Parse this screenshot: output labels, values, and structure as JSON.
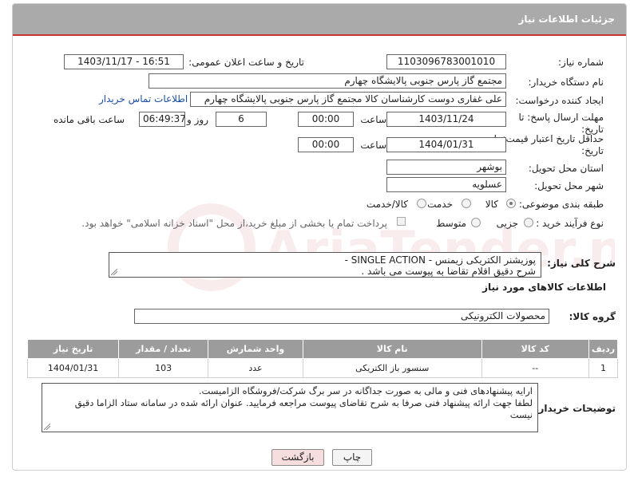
{
  "header": {
    "title": "جزئیات اطلاعات نیاز"
  },
  "watermark": {
    "text": "AriaTender.neT"
  },
  "fields": {
    "need_number_label": "شماره نیاز:",
    "need_number": "1103096783001010",
    "announce_label": "تاریخ و ساعت اعلان عمومی:",
    "announce_value": "1403/11/17 - 16:51",
    "buyer_label": "نام دستگاه خریدار:",
    "buyer_value": "مجتمع گاز پارس جنوبی  پالایشگاه چهارم",
    "creator_label": "ایجاد کننده درخواست:",
    "creator_value": "علی غفاری دوست کارشناسان کالا مجتمع گاز پارس جنوبی  پالایشگاه چهارم",
    "contact_link": "اطلاعات تماس خریدار",
    "deadline_label_1": "مهلت ارسال پاسخ: تا",
    "deadline_label_2": "تاریخ:",
    "deadline_date": "1403/11/24",
    "time_label": "ساعت",
    "deadline_time": "00:00",
    "days_value": "6",
    "days_label": "روز و",
    "remaining_time": "06:49:37",
    "remaining_label": "ساعت باقی مانده",
    "validity_label_1": "حداقل تاریخ اعتبار قیمت: تا",
    "validity_label_2": "تاریخ:",
    "validity_date": "1404/01/31",
    "validity_time": "00:00",
    "province_label": "استان محل تحویل:",
    "province_value": "بوشهر",
    "city_label": "شهر محل تحویل:",
    "city_value": "عسلویه",
    "category_label": "طبقه بندی موضوعی:",
    "category_options": [
      "کالا",
      "خدمت",
      "کالا/خدمت"
    ],
    "process_label": "نوع فرآیند خرید :",
    "process_options": [
      "جزیی",
      "متوسط"
    ],
    "payment_note": "پرداخت تمام یا بخشی از مبلغ خرید،از محل \"اسناد خزانه اسلامی\" خواهد بود."
  },
  "description": {
    "label": "شرح کلی نیاز:",
    "line1": "پوزیشنر الکتریکی زیمنس - SINGLE ACTION -",
    "line2": "شرح دقیق اقلام تقاضا به پیوست می باشد ."
  },
  "goods_section": {
    "title": "اطلاعات کالاهای مورد نیاز",
    "group_label": "گروه کالا:",
    "group_value": "محصولات الکترونیکی"
  },
  "table": {
    "headers": [
      "ردیف",
      "کد کالا",
      "نام کالا",
      "واحد شمارش",
      "تعداد / مقدار",
      "تاریخ نیاز"
    ],
    "rows": [
      [
        "1",
        "--",
        "سنسور باز الکتریکی",
        "عدد",
        "103",
        "1404/01/31"
      ]
    ]
  },
  "buyer_notes": {
    "label": "توضیحات خریدار:",
    "line1": "ارایه پیشنهادهای فنی و مالی به صورت جداگانه در سر برگ شرکت/فروشگاه الزامیست.",
    "line2": "لطفا جهت ارائه پیشنهاد فنی صرفا به شرح تقاضای پیوست مراجعه فرمایید. عنوان ارائه شده در سامانه ستاد الزاما دقیق",
    "line3": "نیست"
  },
  "buttons": {
    "print": "چاپ",
    "back": "بازگشت"
  },
  "colors": {
    "header_bg": "#aaaaaa",
    "accent_red": "#cc3333",
    "table_header_bg": "#9c9c9c",
    "back_button_bg": "#f6dede"
  }
}
